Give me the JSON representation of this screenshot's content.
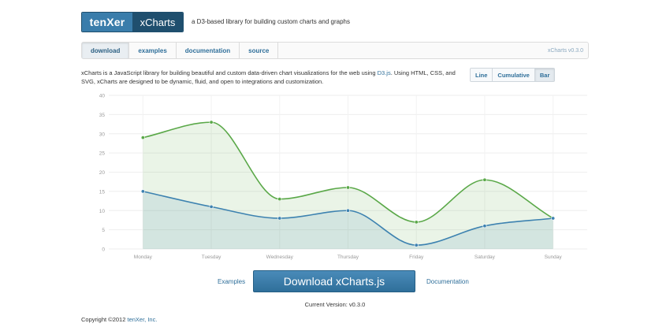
{
  "header": {
    "logo_text": "tenXer",
    "product": "xCharts",
    "tagline": "a D3-based library for building custom charts and graphs"
  },
  "nav": {
    "tabs": [
      {
        "label": "download",
        "active": true
      },
      {
        "label": "examples",
        "active": false
      },
      {
        "label": "documentation",
        "active": false
      },
      {
        "label": "source",
        "active": false
      }
    ],
    "version": "xCharts v0.3.0"
  },
  "intro": {
    "before_link": "xCharts is a JavaScript library for building beautiful and custom data-driven chart visualizations for the web using ",
    "link_text": "D3.js",
    "after_link": ". Using HTML, CSS, and SVG, xCharts are designed to be dynamic, fluid, and open to integrations and customization."
  },
  "chart_controls": [
    {
      "label": "Line",
      "active": false
    },
    {
      "label": "Cumulative",
      "active": false
    },
    {
      "label": "Bar",
      "active": true
    }
  ],
  "chart_data": {
    "type": "area",
    "categories": [
      "Monday",
      "Tuesday",
      "Wednesday",
      "Thursday",
      "Friday",
      "Saturday",
      "Sunday"
    ],
    "series": [
      {
        "values": [
          29,
          33,
          13,
          16,
          7,
          18,
          8
        ],
        "color": "#5aa848"
      },
      {
        "values": [
          15,
          11,
          8,
          10,
          1,
          6,
          8
        ],
        "color": "#3d82b0"
      }
    ],
    "ylim": [
      0,
      40
    ],
    "yticks": [
      0,
      5,
      10,
      15,
      20,
      25,
      30,
      35,
      40
    ],
    "grid": true,
    "title": "",
    "xlabel": "",
    "ylabel": ""
  },
  "actions": {
    "examples_link": "Examples",
    "download_label": "Download xCharts.js",
    "documentation_link": "Documentation",
    "current_version": "Current Version: v0.3.0"
  },
  "footer": {
    "copyright_prefix": "Copyright ©2012 ",
    "company_link": "tenXer, Inc."
  }
}
